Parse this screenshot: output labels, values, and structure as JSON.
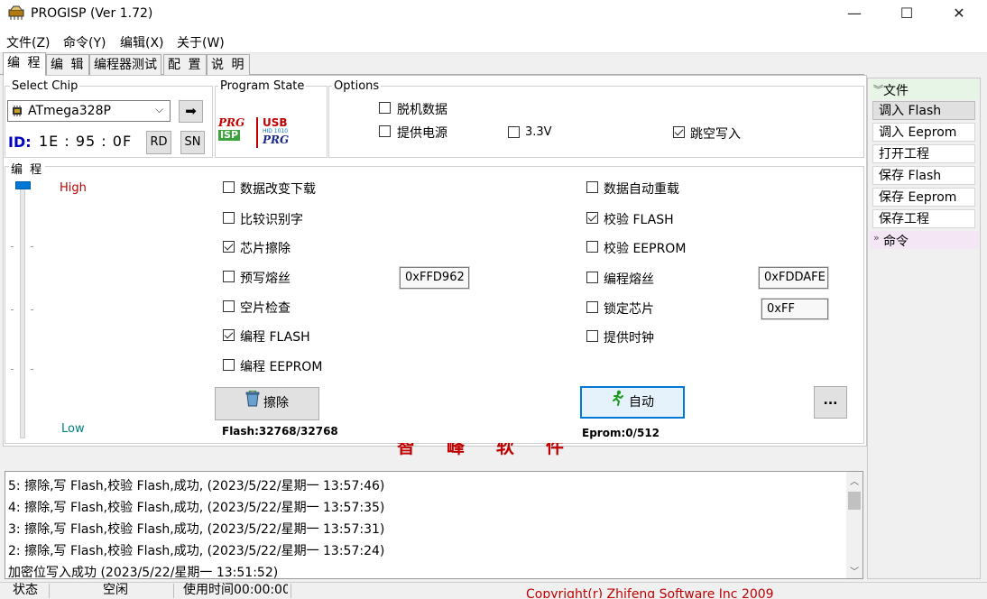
{
  "window": {
    "title": "PROGISP (Ver 1.72)",
    "minimize": "—",
    "maximize": "☐",
    "close": "✕"
  },
  "menu": [
    "文件(Z)",
    "命令(Y)",
    "编辑(X)",
    "关于(W)"
  ],
  "tabs": [
    "编 程",
    "编 辑",
    "编程器测试",
    "配 置",
    "说 明"
  ],
  "select_chip": {
    "label": "Select Chip",
    "chip": "ATmega328P",
    "id_label": "ID:",
    "id_value": "1E : 95 : 0F",
    "rd": "RD",
    "sn": "SN"
  },
  "program_state": {
    "label": "Program State",
    "prg_isp_top": "PRG",
    "prg_isp_bottom": "ISP",
    "usb_top": "USB",
    "usb_bottom": "PRG",
    "usb_small": "HID 1010"
  },
  "options": {
    "label": "Options",
    "items": [
      {
        "label": "脱机数据",
        "checked": false
      },
      {
        "label": "提供电源",
        "checked": false
      },
      {
        "label": "3.3V",
        "checked": false
      },
      {
        "label": "跳空写入",
        "checked": true
      }
    ]
  },
  "program": {
    "label": "编 程",
    "high": "High",
    "low": "Low",
    "left_checks": [
      {
        "label": "数据改变下载",
        "checked": false
      },
      {
        "label": "比较识别字",
        "checked": false
      },
      {
        "label": "芯片擦除",
        "checked": true
      },
      {
        "label": "预写熔丝",
        "checked": false
      },
      {
        "label": "空片检查",
        "checked": false
      },
      {
        "label": "编程 FLASH",
        "checked": true
      },
      {
        "label": "编程 EEPROM",
        "checked": false
      }
    ],
    "right_checks": [
      {
        "label": "数据自动重载",
        "checked": false
      },
      {
        "label": "校验 FLASH",
        "checked": true
      },
      {
        "label": "校验 EEPROM",
        "checked": false
      },
      {
        "label": "编程熔丝",
        "checked": false
      },
      {
        "label": "锁定芯片",
        "checked": false
      },
      {
        "label": "提供时钟",
        "checked": false
      }
    ],
    "fuse_pre": "0xFFD962",
    "fuse_prog": "0xFDDAFE",
    "lock": "0xFF",
    "erase_button": "擦除",
    "auto_button": "自动",
    "more_button": "...",
    "flash_info": "Flash:32768/32768",
    "eprom_info": "Eprom:0/512",
    "brand_partial": "智 峰 软 件"
  },
  "right_panel": {
    "file_header": "文件",
    "items": [
      "调入 Flash",
      "调入 Eeprom",
      "打开工程",
      "保存 Flash",
      "保存 Eeprom",
      "保存工程"
    ],
    "cmd_header": "命令"
  },
  "log": [
    "5: 擦除,写 Flash,校验 Flash,成功, (2023/5/22/星期一 13:57:46)",
    "4: 擦除,写 Flash,校验 Flash,成功, (2023/5/22/星期一 13:57:35)",
    "3: 擦除,写 Flash,校验 Flash,成功, (2023/5/22/星期一 13:57:31)",
    "2: 擦除,写 Flash,校验 Flash,成功, (2023/5/22/星期一 13:57:24)",
    "加密位写入成功 (2023/5/22/星期一 13:51:52)"
  ],
  "status": {
    "label": "状态",
    "state": "空闲",
    "time": "使用时间00:00:00",
    "copyright": "Copyright(r) Zhifeng Software Inc 2009"
  },
  "colors": {
    "accent_red": "#c00000",
    "id_blue": "#0000c0",
    "low_teal": "#008080"
  }
}
